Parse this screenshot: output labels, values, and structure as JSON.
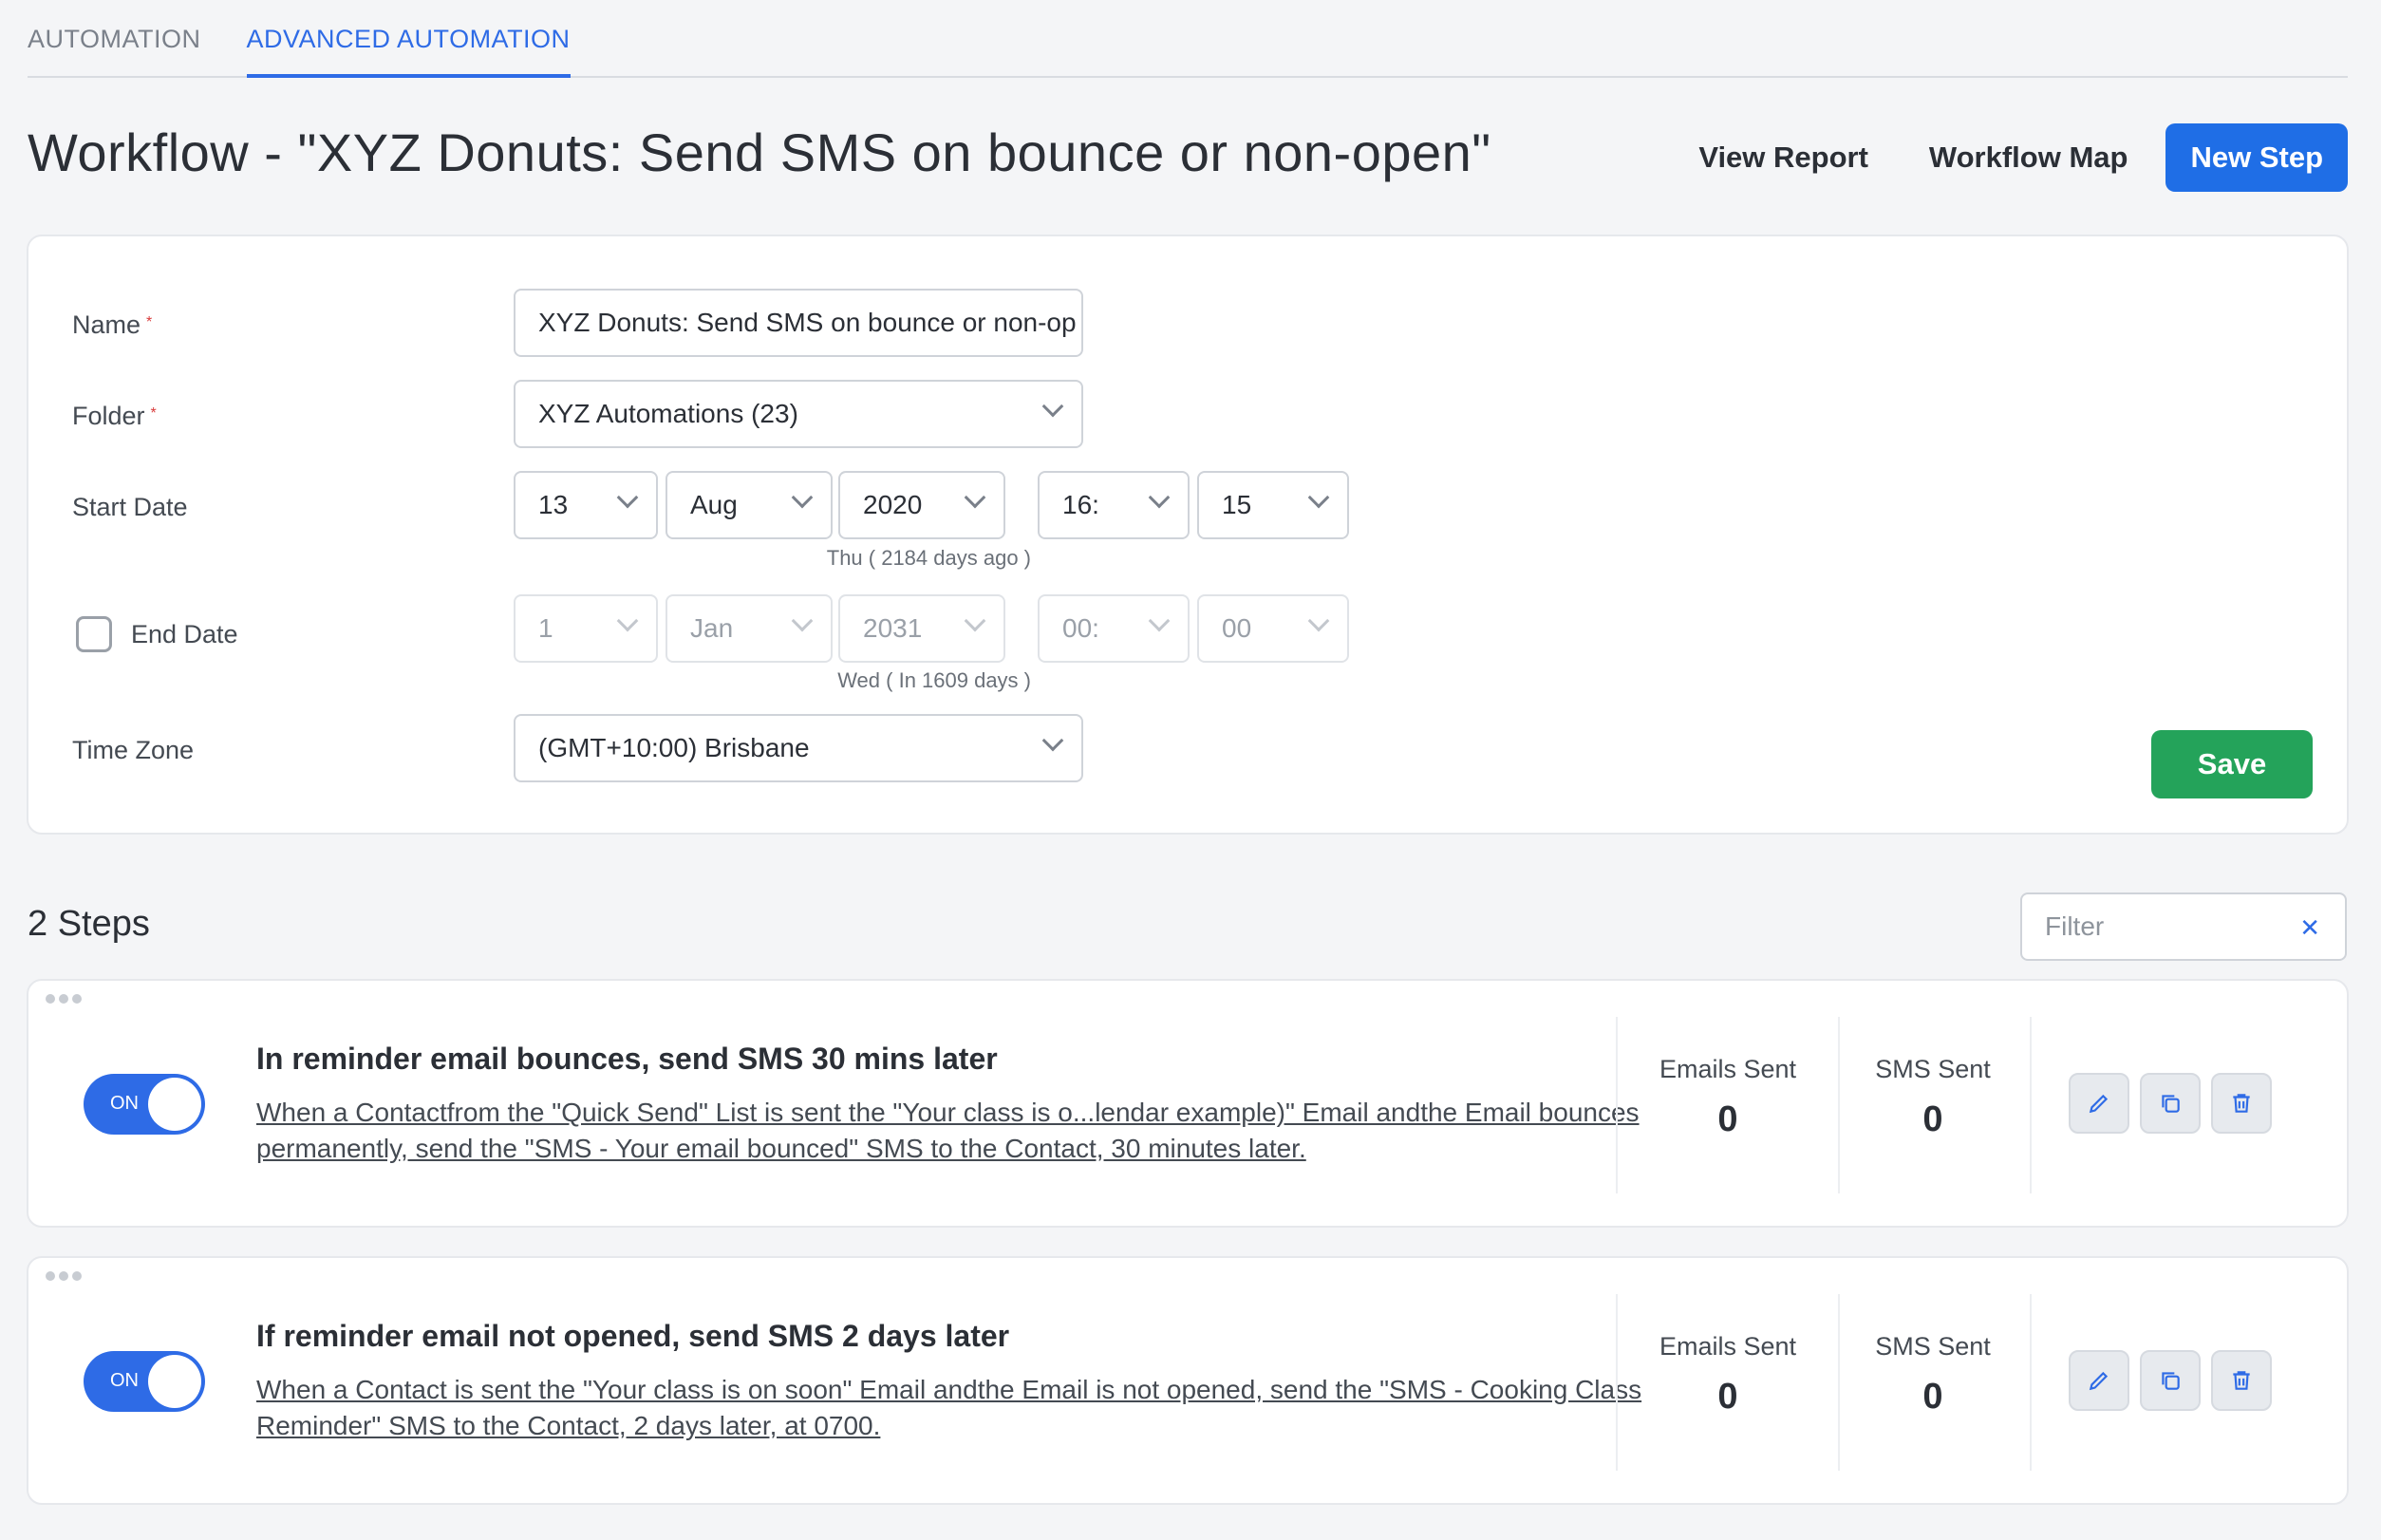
{
  "tabs": [
    {
      "label": "AUTOMATION",
      "active": false
    },
    {
      "label": "ADVANCED AUTOMATION",
      "active": true
    }
  ],
  "header": {
    "title": "Workflow - \"XYZ Donuts: Send SMS on bounce or non-open\"",
    "view_report": "View Report",
    "workflow_map": "Workflow Map",
    "new_step": "New Step"
  },
  "form": {
    "name_label": "Name",
    "name_value": "XYZ Donuts: Send SMS on bounce or non-op",
    "required_mark": "*",
    "folder_label": "Folder",
    "folder_value": "XYZ Automations (23)",
    "start_date_label": "Start Date",
    "start": {
      "day": "13",
      "month": "Aug",
      "year": "2020",
      "hour": "16:",
      "minute": "15",
      "hint": "Thu ( 2184 days ago )"
    },
    "end_date_label": "End Date",
    "end_date_checked": false,
    "end": {
      "day": "1",
      "month": "Jan",
      "year": "2031",
      "hour": "00:",
      "minute": "00",
      "hint": "Wed ( In 1609 days )"
    },
    "timezone_label": "Time Zone",
    "timezone_value": "(GMT+10:00) Brisbane",
    "save": "Save"
  },
  "steps_section": {
    "title": "2 Steps",
    "filter_placeholder": "Filter"
  },
  "steps": [
    {
      "enabled": true,
      "toggle_label": "ON",
      "title": "In reminder email bounces, send SMS 30 mins later",
      "description": "When a Contactfrom the \"Quick Send\" List is sent the \"Your class is o...lendar example)\" Email andthe Email bounces permanently, send the \"SMS - Your email bounced\" SMS to the Contact, 30 minutes later.",
      "emails_sent_label": "Emails Sent",
      "emails_sent": "0",
      "sms_sent_label": "SMS Sent",
      "sms_sent": "0"
    },
    {
      "enabled": true,
      "toggle_label": "ON",
      "title": "If reminder email not opened, send SMS 2 days later",
      "description": "When a Contact is sent the \"Your class is on soon\" Email andthe Email is not opened, send the \"SMS - Cooking Class Reminder\" SMS to the Contact, 2 days later, at 0700.",
      "emails_sent_label": "Emails Sent",
      "emails_sent": "0",
      "sms_sent_label": "SMS Sent",
      "sms_sent": "0"
    }
  ],
  "icons": {
    "edit": "pencil-icon",
    "copy": "copy-icon",
    "delete": "trash-icon",
    "clear": "close-icon",
    "drag": "drag-dots-icon"
  },
  "colors": {
    "accent": "#1f6ee6",
    "save": "#24a35a",
    "toggle_on": "#2e6be6",
    "required": "#d83a3a"
  }
}
